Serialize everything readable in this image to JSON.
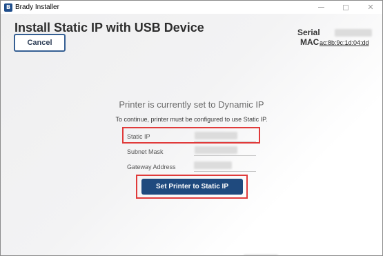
{
  "window": {
    "title": "Brady Installer",
    "icon_letter": "B",
    "controls": {
      "close_glyph": "✕"
    }
  },
  "page": {
    "title": "Install Static IP with USB Device",
    "cancel_label": "Cancel"
  },
  "device": {
    "serial_label": "Serial",
    "mac_label": "MAC",
    "mac_value": "ac:8b:9c:1d:04:dd"
  },
  "main": {
    "heading": "Printer is currently set to Dynamic IP",
    "instruction": "To continue, printer must be configured to use Static IP.",
    "fields": [
      {
        "label": "Static IP"
      },
      {
        "label": "Subnet Mask"
      },
      {
        "label": "Gateway Address"
      }
    ],
    "action_label": "Set Printer to Static IP"
  },
  "colors": {
    "accent": "#1f4a7e",
    "highlight": "#e03a3a",
    "cancel_border": "#355f93"
  }
}
